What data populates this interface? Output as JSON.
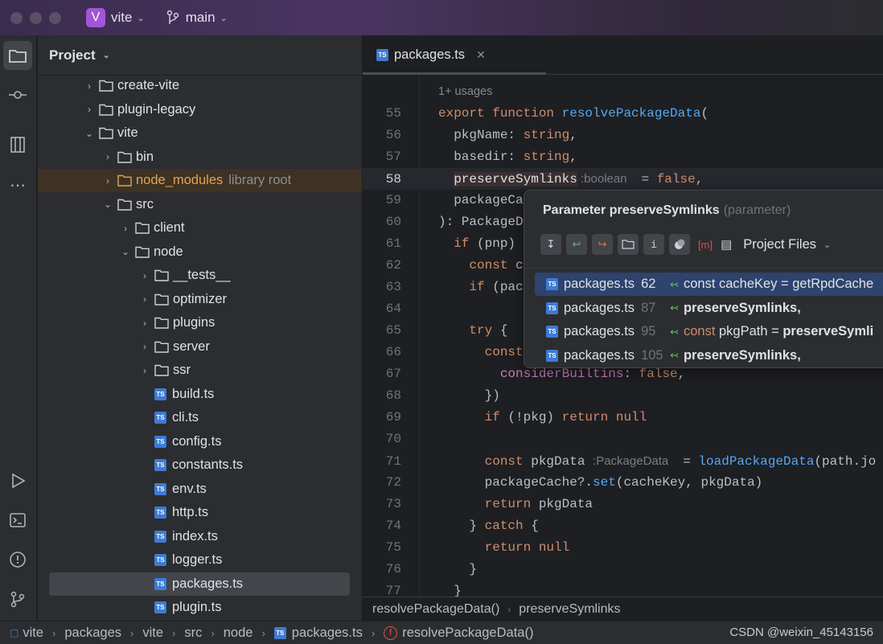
{
  "titlebar": {
    "project_initial": "V",
    "project": "vite",
    "branch": "main"
  },
  "project_panel": {
    "title": "Project",
    "items": [
      {
        "label": "create-vite",
        "type": "folder",
        "level": 1,
        "expanded": false
      },
      {
        "label": "plugin-legacy",
        "type": "folder",
        "level": 1,
        "expanded": false
      },
      {
        "label": "vite",
        "type": "folder",
        "level": 1,
        "expanded": true
      },
      {
        "label": "bin",
        "type": "folder",
        "level": 2,
        "expanded": false
      },
      {
        "label": "node_modules",
        "type": "folder",
        "level": 2,
        "expanded": false,
        "note": "library root",
        "lib": true
      },
      {
        "label": "src",
        "type": "folder",
        "level": 2,
        "expanded": true
      },
      {
        "label": "client",
        "type": "folder",
        "level": 3,
        "expanded": false
      },
      {
        "label": "node",
        "type": "folder",
        "level": 3,
        "expanded": true
      },
      {
        "label": "__tests__",
        "type": "folder",
        "level": 4,
        "expanded": false
      },
      {
        "label": "optimizer",
        "type": "folder",
        "level": 4,
        "expanded": false
      },
      {
        "label": "plugins",
        "type": "folder",
        "level": 4,
        "expanded": false
      },
      {
        "label": "server",
        "type": "folder",
        "level": 4,
        "expanded": false
      },
      {
        "label": "ssr",
        "type": "folder",
        "level": 4,
        "expanded": false
      },
      {
        "label": "build.ts",
        "type": "ts",
        "level": 4
      },
      {
        "label": "cli.ts",
        "type": "ts",
        "level": 4
      },
      {
        "label": "config.ts",
        "type": "ts",
        "level": 4
      },
      {
        "label": "constants.ts",
        "type": "ts",
        "level": 4
      },
      {
        "label": "env.ts",
        "type": "ts",
        "level": 4
      },
      {
        "label": "http.ts",
        "type": "ts",
        "level": 4
      },
      {
        "label": "index.ts",
        "type": "ts",
        "level": 4
      },
      {
        "label": "logger.ts",
        "type": "ts",
        "level": 4
      },
      {
        "label": "packages.ts",
        "type": "ts",
        "level": 4,
        "selected": true
      },
      {
        "label": "plugin.ts",
        "type": "ts",
        "level": 4
      }
    ]
  },
  "editor": {
    "tab": {
      "label": "packages.ts",
      "icon": "TS"
    },
    "usages": "1+ usages",
    "lines": [
      {
        "n": "55",
        "t": [
          [
            "k",
            "export function "
          ],
          [
            "f",
            "resolvePackageData"
          ],
          [
            "d",
            "("
          ]
        ]
      },
      {
        "n": "56",
        "t": [
          [
            "d",
            "  pkgName: "
          ],
          [
            "k",
            "string"
          ],
          [
            "d",
            ","
          ]
        ]
      },
      {
        "n": "57",
        "t": [
          [
            "d",
            "  basedir: "
          ],
          [
            "k",
            "string"
          ],
          [
            "d",
            ","
          ]
        ]
      },
      {
        "n": "58",
        "cur": true,
        "t": [
          [
            "d",
            "  "
          ],
          [
            "hl",
            "preserveSymlinks"
          ],
          [
            "h",
            " :boolean  "
          ],
          [
            "d",
            " = "
          ],
          [
            "k",
            "false"
          ],
          [
            "d",
            ","
          ]
        ]
      },
      {
        "n": "59",
        "t": [
          [
            "d",
            "  packageCa"
          ]
        ]
      },
      {
        "n": "60",
        "t": [
          [
            "d",
            "): PackageD"
          ]
        ]
      },
      {
        "n": "61",
        "t": [
          [
            "d",
            "  "
          ],
          [
            "k",
            "if"
          ],
          [
            "d",
            " (pnp)"
          ]
        ]
      },
      {
        "n": "62",
        "t": [
          [
            "d",
            "    "
          ],
          [
            "k",
            "const"
          ],
          [
            "d",
            " c"
          ]
        ]
      },
      {
        "n": "63",
        "t": [
          [
            "d",
            "    "
          ],
          [
            "k",
            "if"
          ],
          [
            "d",
            " (pac"
          ]
        ]
      },
      {
        "n": "64",
        "t": []
      },
      {
        "n": "65",
        "t": [
          [
            "d",
            "    "
          ],
          [
            "k",
            "try"
          ],
          [
            "d",
            " {"
          ]
        ]
      },
      {
        "n": "66",
        "t": [
          [
            "d",
            "      "
          ],
          [
            "k",
            "const"
          ]
        ]
      },
      {
        "n": "67",
        "t": [
          [
            "d",
            "        "
          ],
          [
            "p",
            "considerBuiltins"
          ],
          [
            "d",
            ": "
          ],
          [
            "k",
            "false"
          ],
          [
            "d",
            ","
          ]
        ]
      },
      {
        "n": "68",
        "t": [
          [
            "d",
            "      })"
          ]
        ]
      },
      {
        "n": "69",
        "t": [
          [
            "d",
            "      "
          ],
          [
            "k",
            "if"
          ],
          [
            "d",
            " (!pkg) "
          ],
          [
            "k",
            "return null"
          ]
        ]
      },
      {
        "n": "70",
        "t": []
      },
      {
        "n": "71",
        "t": [
          [
            "d",
            "      "
          ],
          [
            "k",
            "const"
          ],
          [
            "d",
            " pkgData "
          ],
          [
            "h",
            ":PackageData  "
          ],
          [
            "d",
            " = "
          ],
          [
            "f",
            "loadPackageData"
          ],
          [
            "d",
            "(path.jo"
          ]
        ]
      },
      {
        "n": "72",
        "t": [
          [
            "d",
            "      packageCache?."
          ],
          [
            "f",
            "set"
          ],
          [
            "d",
            "(cacheKey, pkgData)"
          ]
        ]
      },
      {
        "n": "73",
        "t": [
          [
            "d",
            "      "
          ],
          [
            "k",
            "return"
          ],
          [
            "d",
            " pkgData"
          ]
        ]
      },
      {
        "n": "74",
        "t": [
          [
            "d",
            "    } "
          ],
          [
            "k",
            "catch"
          ],
          [
            "d",
            " {"
          ]
        ]
      },
      {
        "n": "75",
        "t": [
          [
            "d",
            "      "
          ],
          [
            "k",
            "return null"
          ]
        ]
      },
      {
        "n": "76",
        "t": [
          [
            "d",
            "    }"
          ]
        ]
      },
      {
        "n": "77",
        "t": [
          [
            "d",
            "  }"
          ]
        ]
      }
    ],
    "breadcrumbs": [
      "resolvePackageData()",
      "preserveSymlinks"
    ]
  },
  "popup": {
    "title": "Parameter preserveSymlinks",
    "subtitle": "(parameter)",
    "scope": "Project Files",
    "tools": [
      "merge-usages-icon",
      "read-access-icon",
      "write-access-icon",
      "folder-filter-icon",
      "info-icon",
      "group-icon",
      "module-icon",
      "preview-icon"
    ],
    "results": [
      {
        "file": "packages.ts",
        "line": "62",
        "pre_kw": "",
        "text": "const cacheKey = getRpdCache",
        "bold": false,
        "selected": true
      },
      {
        "file": "packages.ts",
        "line": "87",
        "pre_kw": "",
        "text": "preserveSymlinks,",
        "bold": true
      },
      {
        "file": "packages.ts",
        "line": "95",
        "pre_kw": "const",
        "text": " pkgPath = ",
        "bold_tail": "preserveSymli"
      },
      {
        "file": "packages.ts",
        "line": "105",
        "pre_kw": "",
        "text": "preserveSymlinks,",
        "bold": true
      }
    ]
  },
  "statusbar": {
    "path": [
      "vite",
      "packages",
      "vite",
      "src",
      "node",
      "packages.ts",
      "resolvePackageData()"
    ],
    "watermark": "CSDN @weixin_45143156"
  },
  "colors": {
    "accent": "#a155d9",
    "keyword": "#cf8e6d",
    "function": "#56a8f5",
    "property": "#c77dbb",
    "selection": "#2e436e"
  }
}
